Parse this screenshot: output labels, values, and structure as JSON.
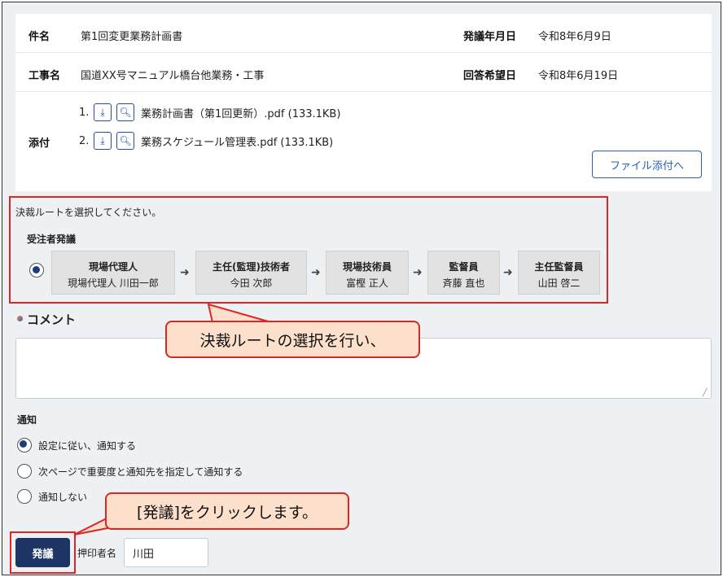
{
  "info": {
    "subject_label": "件名",
    "subject_value": "第1回変更業務計画書",
    "issue_date_label": "発議年月日",
    "issue_date_value": "令和8年6月9日",
    "work_label": "工事名",
    "work_value": "国道XX号マニュアル橋台他業務・工事",
    "reply_date_label": "回答希望日",
    "reply_date_value": "令和8年6月19日",
    "attach_label": "添付",
    "attachments": [
      {
        "num": "1.",
        "name": "業務計画書（第1回更新）.pdf (133.1KB)"
      },
      {
        "num": "2.",
        "name": "業務スケジュール管理表.pdf (133.1KB)"
      }
    ],
    "attach_button": "ファイル添付へ"
  },
  "route": {
    "hint": "決裁ルートを選択してください。",
    "group": "受注者発議",
    "steps": [
      {
        "title": "現場代理人",
        "person": "現場代理人 川田一郎"
      },
      {
        "title": "主任(監理)技術者",
        "person": "今田 次郎"
      },
      {
        "title": "現場技術員",
        "person": "富樫 正人"
      },
      {
        "title": "監督員",
        "person": "斉藤 直也"
      },
      {
        "title": "主任監督員",
        "person": "山田 啓二"
      }
    ]
  },
  "comment": {
    "title": "コメント",
    "value": ""
  },
  "notify": {
    "title": "通知",
    "options": [
      "設定に従い、通知する",
      "次ページで重要度と通知先を指定して通知する",
      "通知しない"
    ],
    "selected": 0
  },
  "bottom": {
    "issue_button": "発議",
    "stamp_label": "押印者名",
    "stamp_value": "川田"
  },
  "callouts": {
    "route": "決裁ルートの選択を行い、",
    "issue": "[発議]をクリックします。"
  },
  "colors": {
    "accent": "#1d3564",
    "highlight": "#e02424",
    "callout_bg": "#fde0cc",
    "link": "#2b5fb4"
  }
}
